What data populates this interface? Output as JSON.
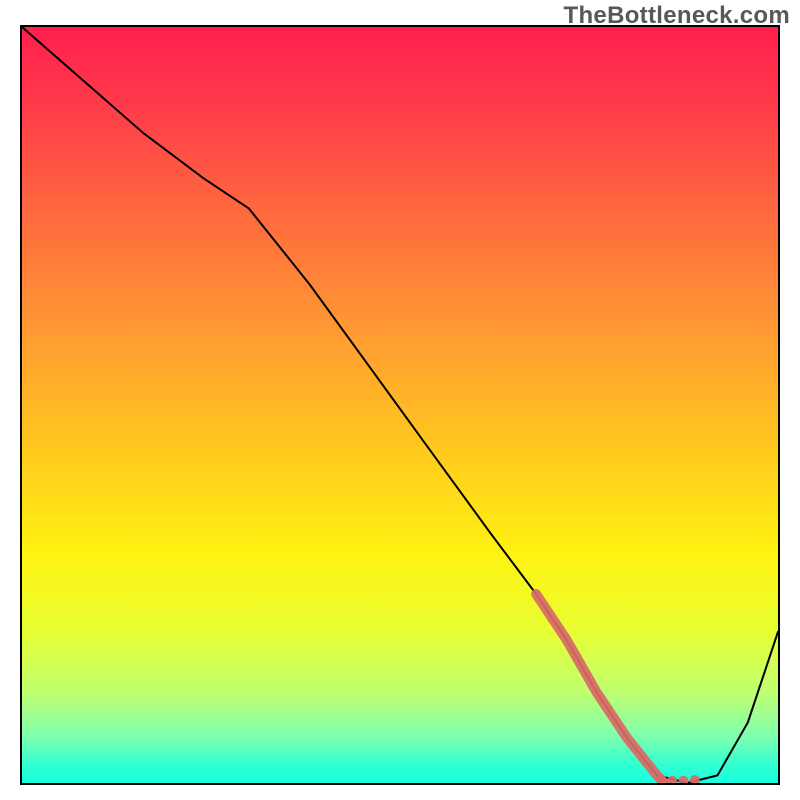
{
  "watermark": {
    "text": "TheBottleneck.com"
  },
  "colors": {
    "frame": "#000000",
    "curve_stroke": "#000000",
    "highlight_stroke": "#d86a66"
  },
  "chart_data": {
    "type": "line",
    "title": "",
    "xlabel": "",
    "ylabel": "",
    "xlim": [
      0,
      100
    ],
    "ylim": [
      0,
      100
    ],
    "gradient_stops": [
      {
        "offset": 0.0,
        "color": "#ff1f4d"
      },
      {
        "offset": 0.1,
        "color": "#ff3a4a"
      },
      {
        "offset": 0.25,
        "color": "#ff6a3e"
      },
      {
        "offset": 0.4,
        "color": "#ff9933"
      },
      {
        "offset": 0.55,
        "color": "#ffc61f"
      },
      {
        "offset": 0.7,
        "color": "#fff311"
      },
      {
        "offset": 0.8,
        "color": "#e6ff33"
      },
      {
        "offset": 0.88,
        "color": "#bfff70"
      },
      {
        "offset": 0.94,
        "color": "#7cffb0"
      },
      {
        "offset": 0.975,
        "color": "#33ffd1"
      },
      {
        "offset": 1.0,
        "color": "#19ffe0"
      }
    ],
    "series": [
      {
        "name": "bottleneck_curve",
        "x": [
          0,
          8,
          16,
          24,
          30,
          38,
          46,
          54,
          62,
          68,
          72,
          76,
          80,
          84,
          88,
          92,
          96,
          100
        ],
        "y": [
          100,
          93,
          86,
          80,
          76,
          66,
          55,
          44,
          33,
          25,
          19,
          12,
          6,
          1,
          0,
          1,
          8,
          20
        ]
      }
    ],
    "highlight_segment": {
      "x": [
        68,
        72,
        76,
        80,
        84,
        85
      ],
      "y": [
        25,
        19,
        12,
        6,
        1,
        0
      ]
    },
    "highlight_dots": {
      "x": [
        84.5,
        86,
        87.5,
        89
      ],
      "y": [
        0.5,
        0.3,
        0.3,
        0.4
      ]
    }
  }
}
